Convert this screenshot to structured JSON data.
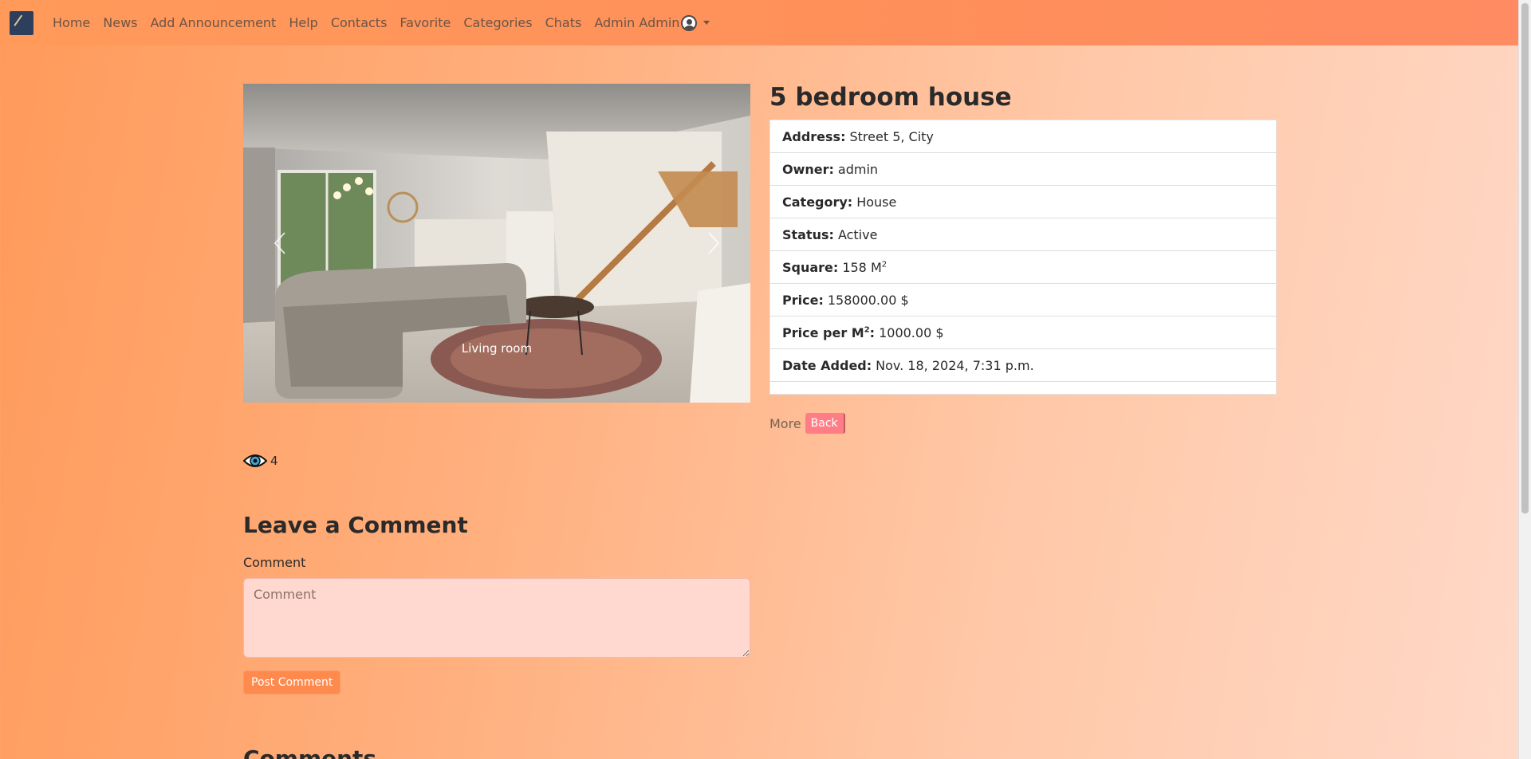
{
  "nav": {
    "items": [
      {
        "label": "Home"
      },
      {
        "label": "News"
      },
      {
        "label": "Add Announcement"
      },
      {
        "label": "Help"
      },
      {
        "label": "Contacts"
      },
      {
        "label": "Favorite"
      },
      {
        "label": "Categories"
      },
      {
        "label": "Chats"
      }
    ],
    "user_label": "Admin Admin"
  },
  "carousel": {
    "caption": "Living room"
  },
  "listing": {
    "title": "5 bedroom house",
    "details": [
      {
        "label": "Address:",
        "value": "Street 5, City"
      },
      {
        "label": "Owner:",
        "value": "admin"
      },
      {
        "label": "Category:",
        "value": "House"
      },
      {
        "label": "Status:",
        "value": "Active"
      },
      {
        "label": "Square:",
        "value": "158 M",
        "sup": "2"
      },
      {
        "label": "Price:",
        "value": "158000.00 $"
      },
      {
        "label": "Price per M",
        "label_sup": "2",
        "label_after": ":",
        "value": "1000.00 $"
      },
      {
        "label": "Date Added:",
        "value": "Nov. 18, 2024, 7:31 p.m."
      }
    ],
    "more_label": "More",
    "back_label": "Back",
    "views": "4"
  },
  "comment_form": {
    "title": "Leave a Comment",
    "label": "Comment",
    "placeholder": "Comment",
    "submit_label": "Post Comment"
  },
  "comments": {
    "heading": "Comments"
  }
}
